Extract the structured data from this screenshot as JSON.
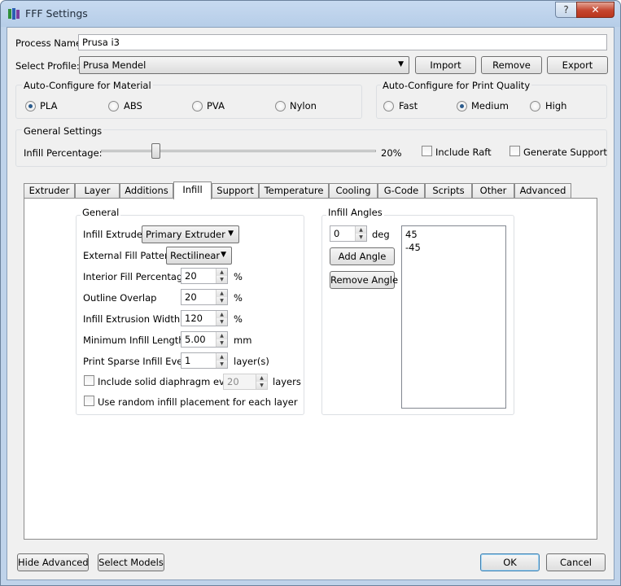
{
  "window": {
    "title": "FFF Settings",
    "help": "?",
    "close": "✕"
  },
  "process": {
    "label": "Process Name:",
    "value": "Prusa i3"
  },
  "profile": {
    "label": "Select Profile:",
    "value": "Prusa Mendel",
    "import": "Import",
    "remove": "Remove",
    "export": "Export"
  },
  "material": {
    "title": "Auto-Configure for Material",
    "options": [
      "PLA",
      "ABS",
      "PVA",
      "Nylon"
    ],
    "selected": "PLA"
  },
  "quality": {
    "title": "Auto-Configure for Print Quality",
    "options": [
      "Fast",
      "Medium",
      "High"
    ],
    "selected": "Medium"
  },
  "general": {
    "title": "General Settings",
    "infill_label": "Infill Percentage:",
    "infill_value": "20%",
    "infill_fraction": 0.2,
    "raft_label": "Include Raft",
    "support_label": "Generate Support"
  },
  "tabs": [
    "Extruder",
    "Layer",
    "Additions",
    "Infill",
    "Support",
    "Temperature",
    "Cooling",
    "G-Code",
    "Scripts",
    "Other",
    "Advanced"
  ],
  "active_tab": "Infill",
  "infill": {
    "general_title": "General",
    "extruder_label": "Infill Extruder",
    "extruder_value": "Primary Extruder",
    "pattern_label": "External Fill Pattern",
    "pattern_value": "Rectilinear",
    "interior_label": "Interior Fill Percentage",
    "interior_value": "20",
    "interior_unit": "%",
    "overlap_label": "Outline Overlap",
    "overlap_value": "20",
    "overlap_unit": "%",
    "width_label": "Infill Extrusion Width",
    "width_value": "120",
    "width_unit": "%",
    "minlen_label": "Minimum Infill Length",
    "minlen_value": "5.00",
    "minlen_unit": "mm",
    "sparse_label": "Print Sparse Infill Every",
    "sparse_value": "1",
    "sparse_unit": "layer(s)",
    "diaphragm_label": "Include solid diaphragm every",
    "diaphragm_value": "20",
    "diaphragm_unit": "layers",
    "random_label": "Use random infill placement for each layer"
  },
  "angles": {
    "title": "Infill Angles",
    "input_value": "0",
    "unit": "deg",
    "add": "Add Angle",
    "remove": "Remove Angle",
    "list": [
      "45",
      "-45"
    ]
  },
  "footer": {
    "hide_advanced": "Hide Advanced",
    "select_models": "Select Models",
    "ok": "OK",
    "cancel": "Cancel"
  }
}
